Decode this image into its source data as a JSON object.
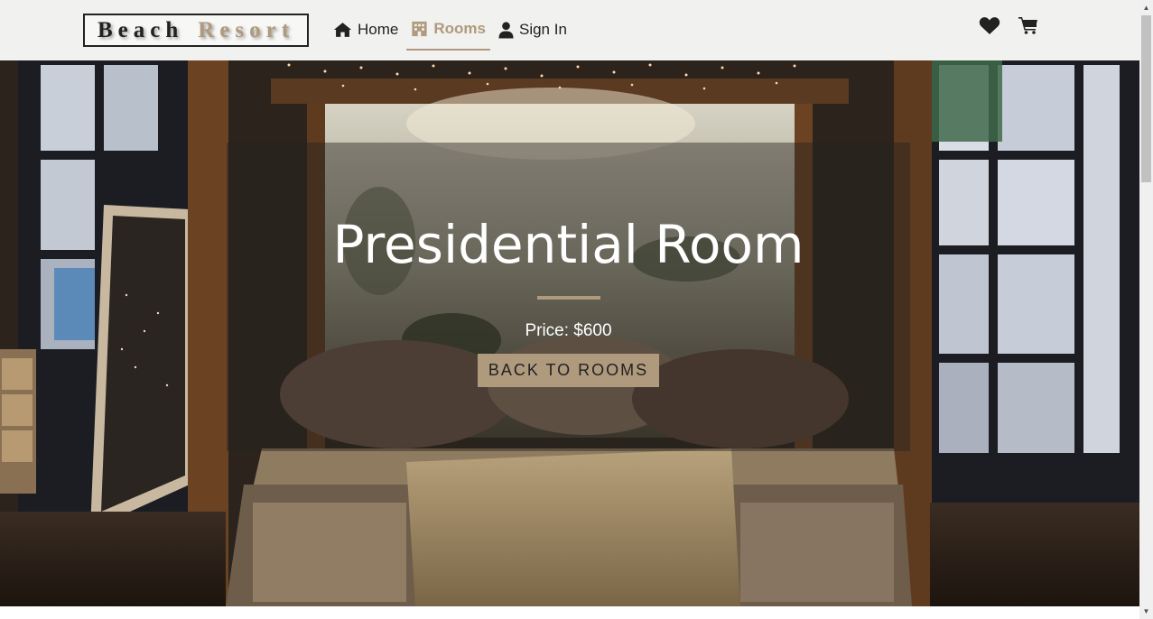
{
  "logo": {
    "word1": "Beach",
    "word2": "Resort"
  },
  "nav": {
    "home": "Home",
    "rooms": "Rooms",
    "sign_in": "Sign In"
  },
  "icons": {
    "home": "home-icon",
    "rooms": "hotel-icon",
    "sign_in": "user-icon",
    "favorites": "heart-icon",
    "cart": "cart-icon"
  },
  "hero": {
    "title": "Presidential Room",
    "price": "Price: $600",
    "button": "BACK TO ROOMS"
  },
  "colors": {
    "accent": "#af9a7d",
    "dark": "#222222",
    "navbar_bg": "#f1f1ef"
  }
}
